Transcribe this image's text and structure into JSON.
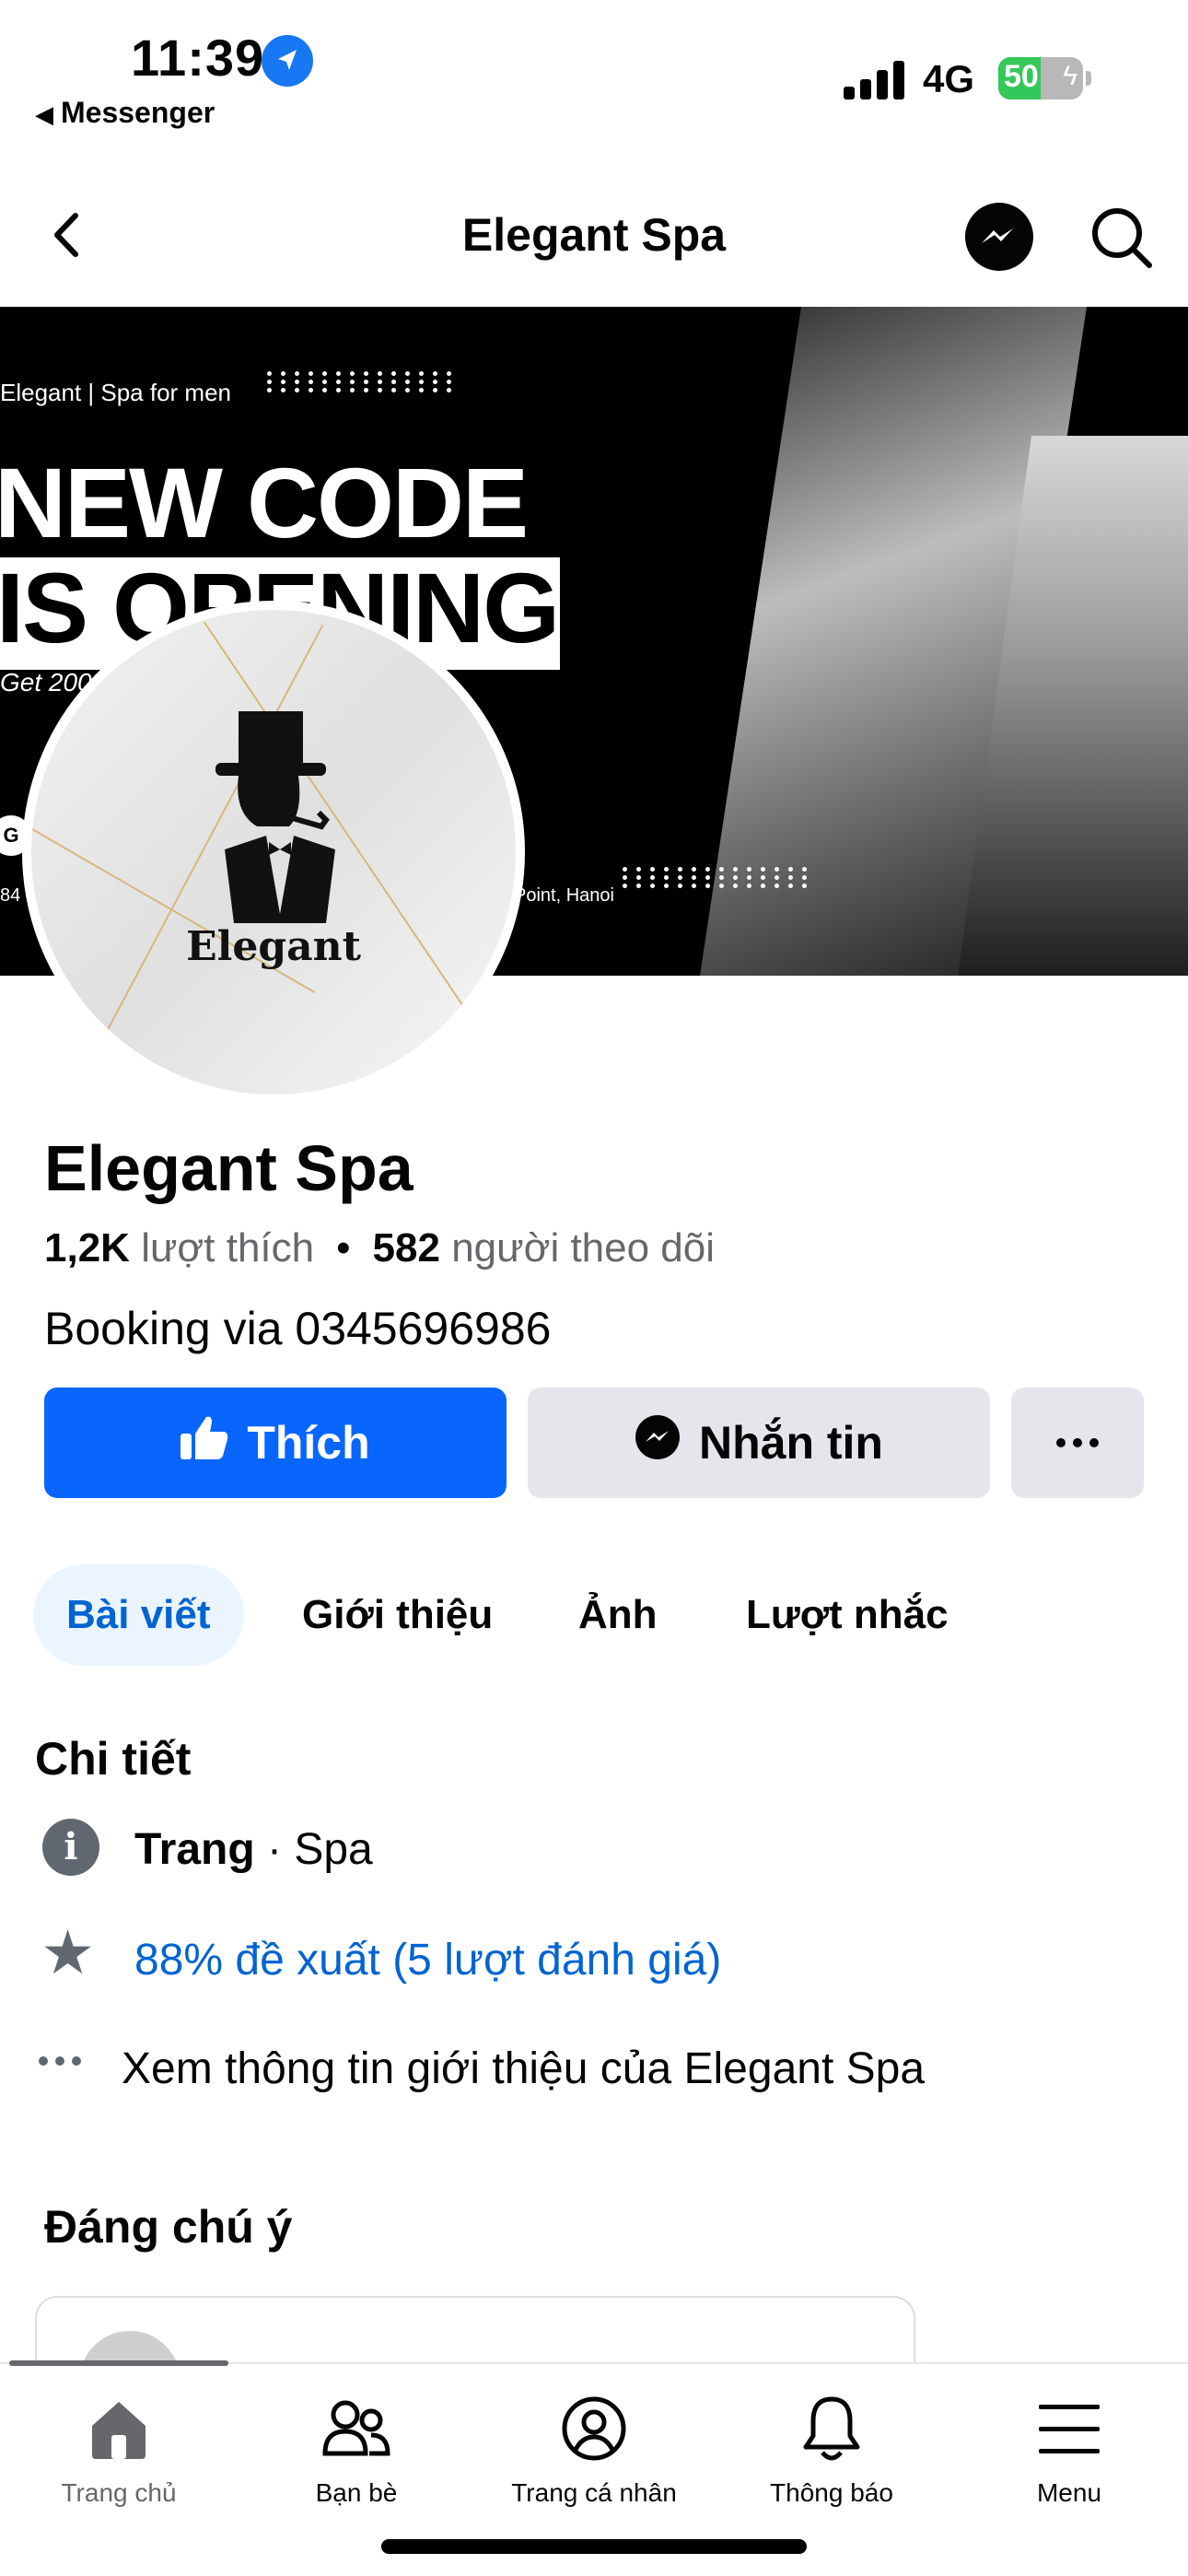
{
  "status_bar": {
    "time": "11:39",
    "back_app": "Messenger",
    "network": "4G",
    "battery": "50",
    "battery_level": 0.5
  },
  "navbar": {
    "title": "Elegant Spa"
  },
  "cover": {
    "tagline": "Elegant | Spa for men",
    "headline1": "NEW CODE",
    "headline2": "IS OPENING",
    "get_text": "Get 200",
    "address_text": "Point, Hanoi",
    "number_text": "84",
    "badge_letter": "G"
  },
  "avatar": {
    "logo_text": "Elegant"
  },
  "page": {
    "name": "Elegant Spa",
    "likes_count": "1,2K",
    "likes_label": "lượt thích",
    "followers_count": "582",
    "followers_label": "người theo dõi",
    "bio": "Booking via 0345696986"
  },
  "actions": {
    "like": "Thích",
    "message": "Nhắn tin"
  },
  "tabs": [
    "Bài viết",
    "Giới thiệu",
    "Ảnh",
    "Lượt nhắc"
  ],
  "details": {
    "title": "Chi tiết",
    "page_type_bold": "Trang",
    "page_type_rest": " · Spa",
    "recommend": "88% đề xuất (5 lượt đánh giá)",
    "about_link": "Xem thông tin giới thiệu của Elegant Spa"
  },
  "noteworthy": {
    "title": "Đáng chú ý"
  },
  "tabbar": {
    "items": [
      "Trang chủ",
      "Bạn bè",
      "Trang cá nhân",
      "Thông báo",
      "Menu"
    ]
  }
}
